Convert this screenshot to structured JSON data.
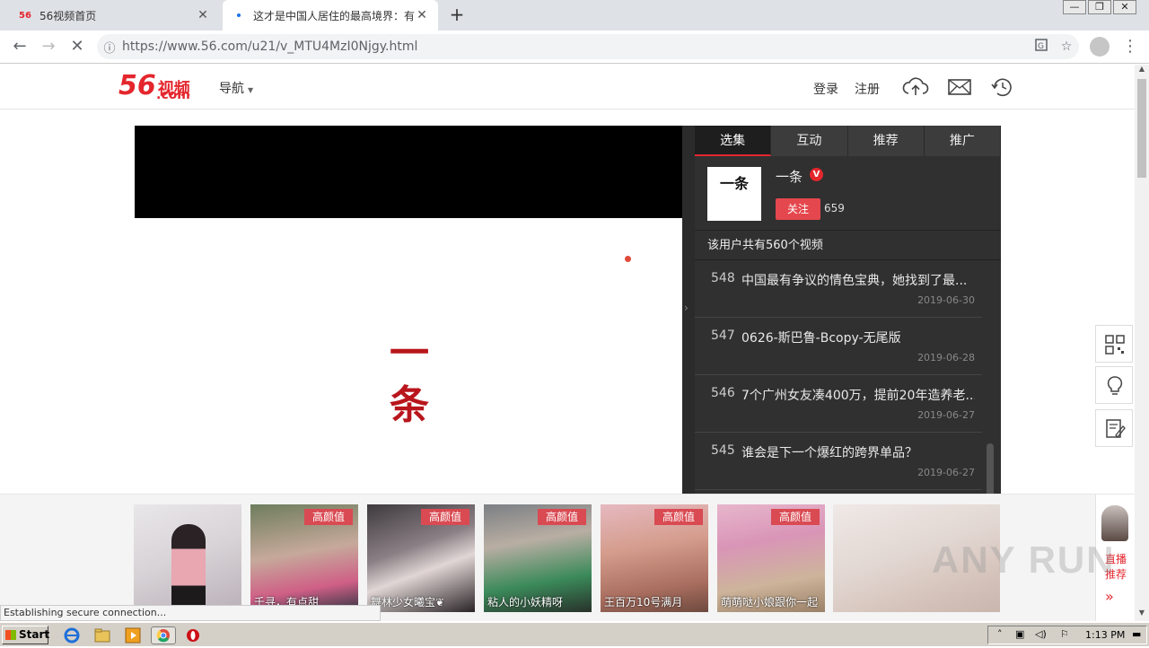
{
  "browser": {
    "tabs": [
      {
        "title": "56视频首页",
        "favicon": "56"
      },
      {
        "title": "这才是中国人居住的最高境界：有水有..."
      }
    ],
    "new_tab": "+",
    "url": "https://www.56.com/u21/v_MTU4MzI0Njgy.html",
    "window_controls": [
      "—",
      "❐",
      "✕"
    ]
  },
  "site": {
    "logo_num": "56",
    "logo_cn": "视频",
    "logo_com": ".com",
    "nav_label": "导航",
    "login": "登录",
    "register": "注册"
  },
  "player": {
    "brand_text": "一条"
  },
  "panel": {
    "tabs": [
      "选集",
      "互动",
      "推荐",
      "推广"
    ],
    "owner_avatar_text": "一条",
    "owner_name": "一条",
    "verified_badge": "V",
    "follow_label": "关注",
    "follow_count": "659",
    "total_videos": "该用户共有560个视频",
    "videos": [
      {
        "num": "548",
        "title": "中国最有争议的情色宝典，她找到了最...",
        "date": "2019-06-30"
      },
      {
        "num": "547",
        "title": "0626-斯巴鲁-Bcopy-无尾版",
        "date": "2019-06-28"
      },
      {
        "num": "546",
        "title": "7个广州女友凑400万，提前20年造养老...",
        "date": "2019-06-27"
      },
      {
        "num": "545",
        "title": "谁会是下一个爆红的跨界单品？",
        "date": "2019-06-27"
      }
    ]
  },
  "live": {
    "cards": [
      {
        "tag": "",
        "caption": ""
      },
      {
        "tag": "高颜值",
        "caption": "千寻，有点甜"
      },
      {
        "tag": "高颜值",
        "caption": "舞林少女曦宝❦"
      },
      {
        "tag": "高颜值",
        "caption": "粘人的小妖精呀"
      },
      {
        "tag": "高颜值",
        "caption": "王百万10号满月"
      },
      {
        "tag": "高颜值",
        "caption": "萌萌哒小娘跟你一起"
      },
      {
        "tag": "",
        "caption": ""
      }
    ],
    "side_label_1": "直播",
    "side_label_2": "推荐",
    "side_arrow": "»"
  },
  "status_text": "Establishing secure connection...",
  "watermark": "ANY RUN",
  "taskbar": {
    "start_label": "Start",
    "clock": "1:13 PM"
  },
  "colors": {
    "brand_red": "#e4262d",
    "panel_bg": "#303030",
    "tag_red": "#d94a52"
  }
}
